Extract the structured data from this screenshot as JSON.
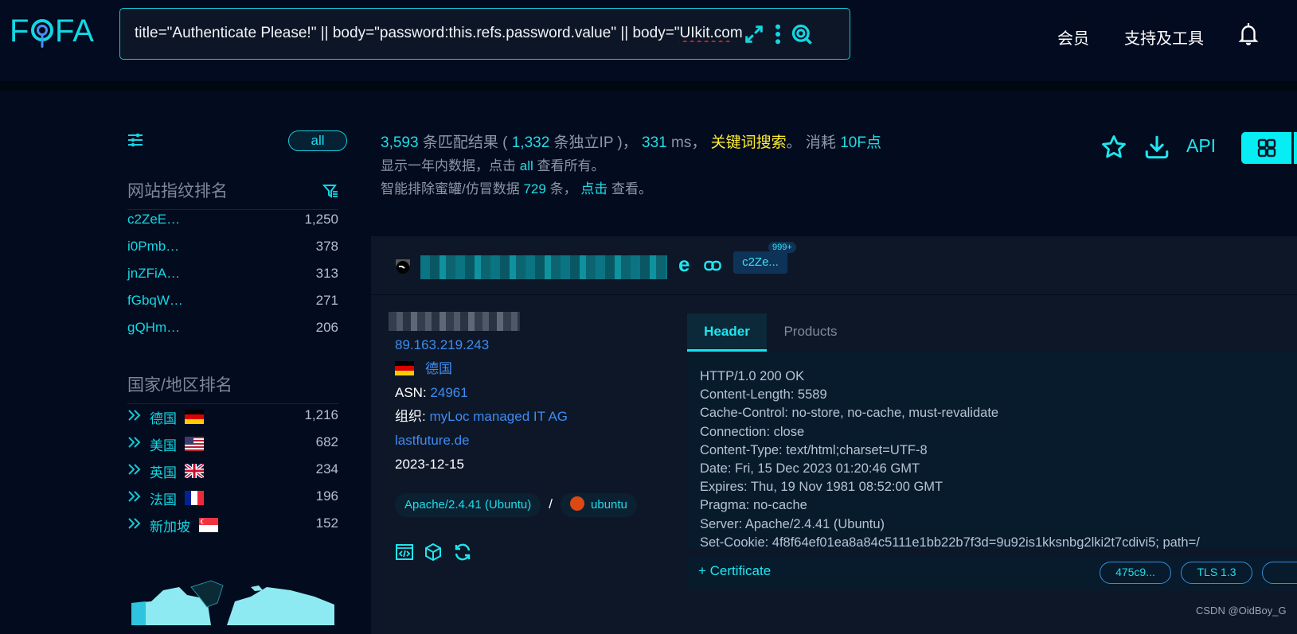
{
  "header": {
    "logo": "FOFA",
    "search_query_main": "title=\"Authenticate Please!\" || body=\"password:this.refs.password.value\" || body=\"",
    "search_query_spell": "UIkit.co",
    "search_query_tail": "m",
    "icons": [
      "expand-icon",
      "more-icon",
      "search-icon"
    ],
    "nav": [
      "会员",
      "支持及工具"
    ],
    "bell": "bell-icon"
  },
  "sidebar": {
    "all_label": "all",
    "fingerprint_title": "网站指纹排名",
    "fingerprints": [
      {
        "name": "c2ZeE…",
        "count": "1,250"
      },
      {
        "name": "i0Pmb…",
        "count": "378"
      },
      {
        "name": "jnZFiA…",
        "count": "313"
      },
      {
        "name": "fGbqW…",
        "count": "271"
      },
      {
        "name": "gQHm…",
        "count": "206"
      }
    ],
    "country_title": "国家/地区排名",
    "countries": [
      {
        "name": "德国",
        "flag": "de",
        "count": "1,216"
      },
      {
        "name": "美国",
        "flag": "us",
        "count": "682"
      },
      {
        "name": "英国",
        "flag": "gb",
        "count": "234"
      },
      {
        "name": "法国",
        "flag": "fr",
        "count": "196"
      },
      {
        "name": "新加坡",
        "flag": "sg",
        "count": "152"
      }
    ]
  },
  "summary": {
    "results": "3,593",
    "results_label": "条匹配结果 (",
    "unique_ip": "1,332",
    "unique_ip_label": "条独立IP )，",
    "time": "331",
    "time_unit": "ms，",
    "keyword_search": "关键词搜索",
    "period": "。 消耗",
    "cost": "10F点",
    "line2_a": "显示一年内数据，点击",
    "line2_all": "all",
    "line2_b": "查看所有。",
    "line3_a": "智能排除蜜罐/仿冒数据",
    "line3_count": "729",
    "line3_b": "条，",
    "line3_click": "点击",
    "line3_c": "查看。",
    "api_label": "API"
  },
  "result": {
    "title_tail": "e",
    "fingerprint_badge": "c2Ze...",
    "fingerprint_count": "999+",
    "ip": "89.163.219.243",
    "country": "德国",
    "asn_label": "ASN:",
    "asn": "24961",
    "org_label": "组织:",
    "org": "myLoc managed IT AG",
    "domain": "lastfuture.de",
    "date": "2023-12-15",
    "server_tag": "Apache/2.4.41 (Ubuntu)",
    "os_tag": "ubuntu",
    "tabs": [
      "Header",
      "Products"
    ],
    "header_lines": [
      "HTTP/1.0 200 OK",
      "Content-Length: 5589",
      "Cache-Control: no-store, no-cache, must-revalidate",
      "Connection: close",
      "Content-Type: text/html;charset=UTF-8",
      "Date: Fri, 15 Dec 2023 01:20:46 GMT",
      "Expires: Thu, 19 Nov 1981 08:52:00 GMT",
      "Pragma: no-cache",
      "Server: Apache/2.4.41 (Ubuntu)",
      "Set-Cookie: 4f8f64ef01ea8a84c5111e1bb22b7f3d=9u92is1kksnbg2lki2t7cdivi5; path=/"
    ],
    "certificate_label": "+ Certificate",
    "cert_pills": [
      "475c9...",
      "TLS 1.3"
    ]
  },
  "watermark": "CSDN @OidBoy_G",
  "colors": {
    "accent": "#14c9d6",
    "link": "#3d8cf2",
    "keyword": "#ffee33",
    "background": "#030c1e"
  }
}
